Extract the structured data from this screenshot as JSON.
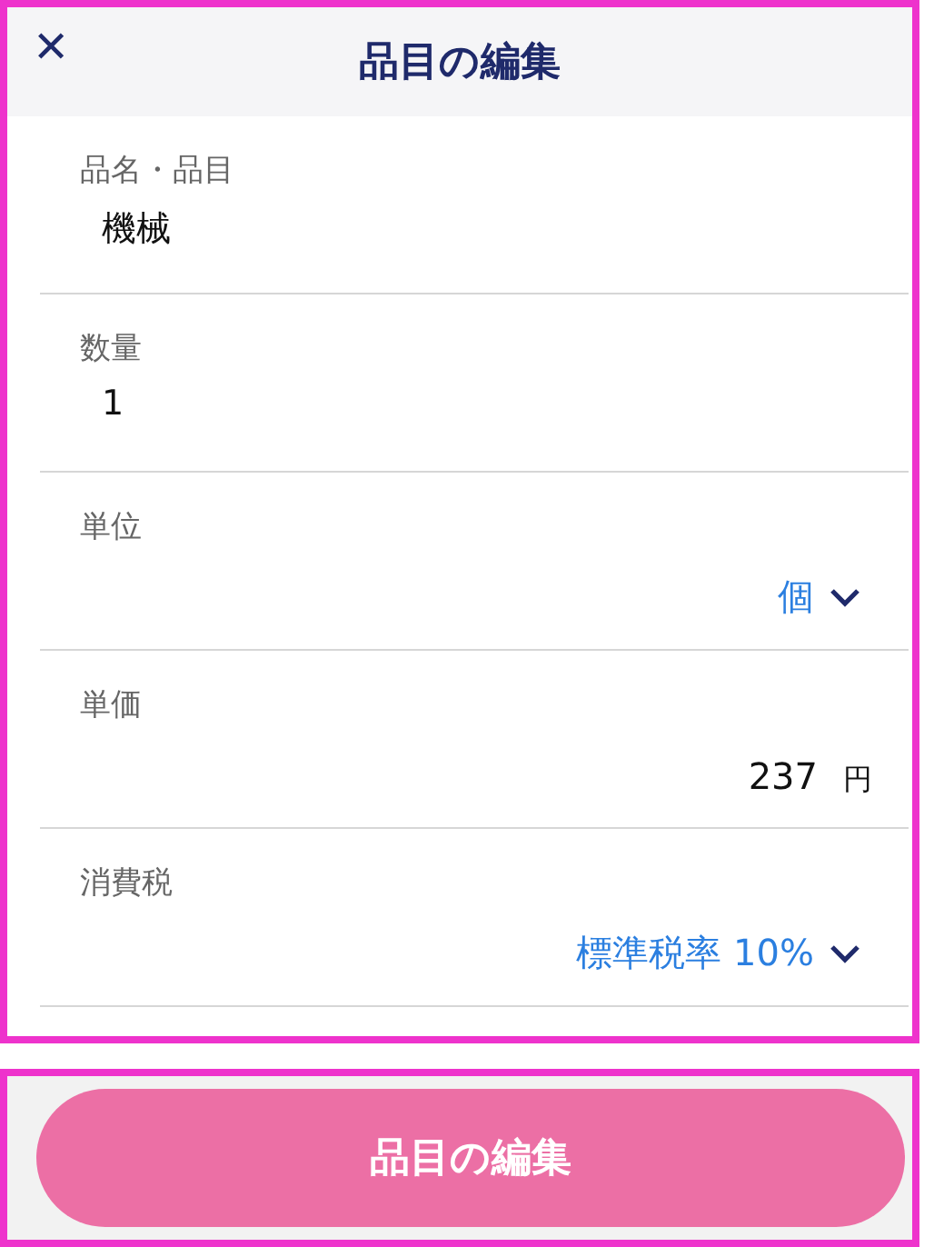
{
  "header": {
    "close": "✕",
    "title": "品目の編集"
  },
  "fields": [
    {
      "kind": "text",
      "label": "品名・品目",
      "value": "機械"
    },
    {
      "kind": "text",
      "label": "数量",
      "value": "1"
    },
    {
      "kind": "select",
      "label": "単位",
      "value": "個"
    },
    {
      "kind": "amount",
      "label": "単価",
      "value": "237",
      "unit": "円"
    },
    {
      "kind": "select",
      "label": "消費税",
      "value": "標準税率 10%"
    }
  ],
  "submit": {
    "label": "品目の編集"
  }
}
